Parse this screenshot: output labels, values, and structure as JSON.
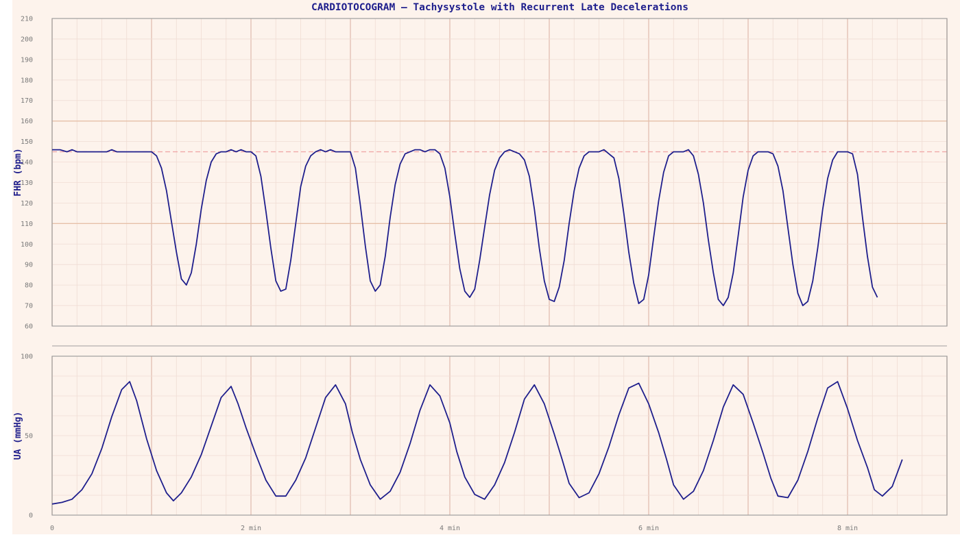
{
  "chart_data": {
    "type": "line",
    "title": "CARDIOTOCOGRAM — Tachysystole with Recurrent Late Decelerations",
    "x_tick_labels": [
      "0",
      "2 min",
      "4 min",
      "6 min",
      "8 min"
    ],
    "x_ticks_min": [
      0,
      2,
      4,
      6,
      8
    ],
    "x_range_min": [
      0,
      9
    ],
    "colors": {
      "trace": "#1e1e8c",
      "paper": "#fdf3ec",
      "minor_grid": "#f0dcd4",
      "major_grid": "#e3c1b5",
      "band_line": "#e6c0a8",
      "baseline": "#f0a8a8",
      "frame": "#9e9e9e"
    },
    "panels": [
      {
        "id": "fhr",
        "ylabel": "FHR (bpm)",
        "ylim": [
          60,
          210
        ],
        "y_ticks": [
          60,
          70,
          80,
          90,
          100,
          110,
          120,
          130,
          140,
          150,
          160,
          170,
          180,
          190,
          200,
          210
        ],
        "y_tick_labels": [
          "60",
          "70",
          "80",
          "90",
          "100",
          "110",
          "120",
          "130",
          "140",
          "150",
          "160",
          "170",
          "180",
          "190",
          "200",
          "210"
        ],
        "normal_band": [
          110,
          160
        ],
        "baseline": 145,
        "series": [
          {
            "x": [
              0,
              0.08,
              0.15,
              0.2,
              0.25,
              0.3,
              0.35,
              0.4,
              0.45,
              0.5,
              0.55,
              0.6,
              0.65,
              0.7,
              0.75,
              0.8,
              0.85,
              0.9,
              0.95,
              1.0,
              1.05,
              1.1,
              1.15,
              1.2,
              1.25,
              1.3,
              1.35,
              1.4,
              1.45,
              1.5,
              1.55,
              1.6,
              1.65,
              1.7,
              1.75,
              1.8,
              1.85,
              1.9,
              1.95,
              2.0,
              2.05,
              2.1,
              2.15,
              2.2,
              2.25,
              2.3,
              2.35,
              2.4,
              2.45,
              2.5,
              2.55,
              2.6,
              2.65,
              2.7,
              2.75,
              2.8,
              2.85,
              2.9,
              2.95,
              3.0,
              3.05,
              3.1,
              3.15,
              3.2,
              3.25,
              3.3,
              3.35,
              3.4,
              3.45,
              3.5,
              3.55,
              3.6,
              3.65,
              3.7,
              3.75,
              3.8,
              3.85,
              3.9,
              3.95,
              4.0,
              4.05,
              4.1,
              4.15,
              4.2,
              4.25,
              4.3,
              4.35,
              4.4,
              4.45,
              4.5,
              4.55,
              4.6,
              4.65,
              4.7,
              4.75,
              4.8,
              4.85,
              4.9,
              4.95,
              5.0,
              5.05,
              5.1,
              5.15,
              5.2,
              5.25,
              5.3,
              5.35,
              5.4,
              5.45,
              5.5,
              5.55,
              5.6,
              5.65,
              5.7,
              5.75,
              5.8,
              5.85,
              5.9,
              5.95,
              6.0,
              6.05,
              6.1,
              6.15,
              6.2,
              6.25,
              6.3,
              6.35,
              6.4,
              6.45,
              6.5,
              6.55,
              6.6,
              6.65,
              6.7,
              6.75,
              6.8,
              6.85,
              6.9,
              6.95,
              7.0,
              7.05,
              7.1,
              7.15,
              7.2,
              7.25,
              7.3,
              7.35,
              7.4,
              7.45,
              7.5,
              7.55,
              7.6,
              7.65,
              7.7,
              7.75,
              7.8,
              7.85,
              7.9,
              7.95,
              8.0,
              8.05,
              8.1,
              8.15,
              8.2,
              8.25,
              8.3,
              8.35,
              8.4,
              8.45,
              8.5,
              8.55,
              8.6,
              8.65,
              8.7,
              8.75,
              8.8,
              8.85,
              8.9,
              8.95,
              9.0
            ],
            "y": [
              146,
              146,
              145,
              146,
              145,
              145,
              145,
              145,
              145,
              145,
              145,
              146,
              145,
              145,
              145,
              145,
              145,
              145,
              145,
              145,
              143,
              137,
              126,
              111,
              96,
              83,
              80,
              86,
              100,
              117,
              131,
              140,
              144,
              145,
              145,
              146,
              145,
              146,
              145,
              145,
              143,
              133,
              116,
              98,
              82,
              77,
              78,
              92,
              110,
              128,
              138,
              143,
              145,
              146,
              145,
              146,
              145,
              145,
              145,
              145,
              137,
              119,
              99,
              82,
              77,
              80,
              94,
              113,
              129,
              139,
              144,
              145,
              146,
              146,
              145,
              146,
              146,
              144,
              137,
              123,
              105,
              88,
              77,
              74,
              78,
              92,
              108,
              124,
              136,
              142,
              145,
              146,
              145,
              144,
              141,
              133,
              117,
              98,
              82,
              73,
              72,
              79,
              92,
              110,
              126,
              137,
              143,
              145,
              145,
              145,
              146,
              144,
              142,
              132,
              115,
              96,
              81,
              71,
              73,
              85,
              103,
              121,
              135,
              143,
              145,
              145,
              145,
              146,
              143,
              134,
              120,
              102,
              86,
              73,
              70,
              74,
              86,
              104,
              123,
              136,
              143,
              145,
              145,
              145,
              144,
              138,
              126,
              108,
              90,
              76,
              70,
              72,
              82,
              98,
              117,
              132,
              141,
              145,
              145,
              145,
              144,
              134,
              113,
              94,
              79,
              74
            ]
          }
        ]
      },
      {
        "id": "ua",
        "ylabel": "UA (mmHg)",
        "ylim": [
          0,
          100
        ],
        "y_ticks": [
          0,
          50,
          100
        ],
        "y_tick_labels": [
          "0",
          "50",
          "100"
        ],
        "series": [
          {
            "x": [
              0,
              0.1,
              0.2,
              0.3,
              0.4,
              0.5,
              0.6,
              0.7,
              0.78,
              0.85,
              0.95,
              1.05,
              1.15,
              1.22,
              1.3,
              1.4,
              1.5,
              1.6,
              1.7,
              1.8,
              1.87,
              1.95,
              2.05,
              2.15,
              2.25,
              2.35,
              2.45,
              2.55,
              2.65,
              2.75,
              2.85,
              2.95,
              3.02,
              3.1,
              3.2,
              3.3,
              3.4,
              3.5,
              3.6,
              3.7,
              3.8,
              3.9,
              4.0,
              4.07,
              4.15,
              4.25,
              4.35,
              4.45,
              4.55,
              4.65,
              4.75,
              4.85,
              4.95,
              5.05,
              5.13,
              5.2,
              5.3,
              5.4,
              5.5,
              5.6,
              5.7,
              5.8,
              5.9,
              6.0,
              6.1,
              6.18,
              6.25,
              6.35,
              6.45,
              6.55,
              6.65,
              6.75,
              6.85,
              6.95,
              7.05,
              7.15,
              7.23,
              7.3,
              7.4,
              7.5,
              7.6,
              7.7,
              7.8,
              7.9,
              8.0,
              8.1,
              8.2,
              8.27,
              8.35,
              8.45,
              8.55,
              8.65,
              8.75,
              8.85,
              8.95,
              9.0
            ],
            "y": [
              7,
              8,
              10,
              16,
              26,
              42,
              62,
              79,
              84,
              72,
              48,
              28,
              14,
              9,
              14,
              24,
              38,
              56,
              74,
              81,
              70,
              55,
              38,
              22,
              12,
              12,
              22,
              36,
              55,
              74,
              82,
              70,
              52,
              35,
              19,
              10,
              15,
              27,
              45,
              66,
              82,
              75,
              58,
              40,
              24,
              13,
              10,
              19,
              33,
              52,
              73,
              82,
              70,
              51,
              35,
              20,
              11,
              14,
              26,
              43,
              63,
              80,
              83,
              70,
              52,
              35,
              19,
              10,
              15,
              28,
              47,
              68,
              82,
              76,
              58,
              39,
              23,
              12,
              11,
              22,
              40,
              61,
              80,
              84,
              67,
              47,
              30,
              16,
              12,
              18,
              35
            ]
          }
        ]
      }
    ]
  }
}
